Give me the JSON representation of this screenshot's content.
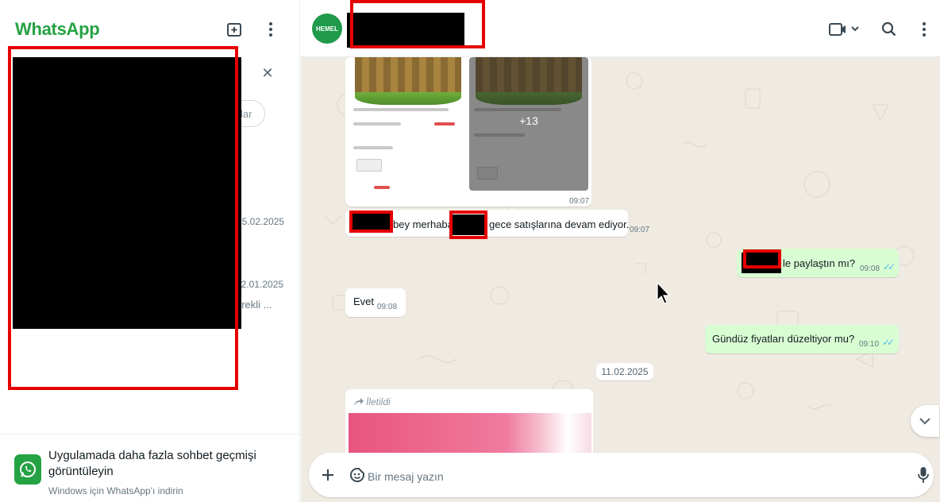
{
  "app": {
    "brand": "WhatsApp"
  },
  "sidebar": {
    "chats": [
      {
        "date": "15.02.2025"
      },
      {
        "date": "12.01.2025",
        "preview": "ürekli ..."
      }
    ],
    "filter_chip_label": "lar",
    "footer": {
      "title": "Uygulamada daha fazla sohbet geçmişi görüntüleyin",
      "subtitle": "Windows için WhatsApp'ı indirin"
    }
  },
  "chat": {
    "avatar_text": "HEMEL",
    "messages": [
      {
        "dir": "in",
        "text": "",
        "time": "09:07",
        "kind": "product-images",
        "extra_count": "+13"
      },
      {
        "dir": "in",
        "text_a": "bey merhaba",
        "text_b": "gece satışlarına devam ediyor.",
        "time": "09:07"
      },
      {
        "dir": "out",
        "text": "le paylaştın mı?",
        "time": "09:08"
      },
      {
        "dir": "in",
        "text": "Evet",
        "time": "09:08"
      },
      {
        "dir": "out",
        "text": "Gündüz fiyatları düzeltiyor mu?",
        "time": "09:10"
      }
    ],
    "date_divider": "11.02.2025",
    "forwarded_label": "İletildi"
  },
  "composer": {
    "placeholder": "Bir mesaj yazın"
  },
  "colors": {
    "brand_green": "#25a244",
    "redaction_red": "#e60000",
    "out_bubble": "#d9fdd3",
    "read_tick": "#53bdeb"
  },
  "icons": [
    "new-chat-icon",
    "menu-icon",
    "close-icon",
    "video-call-icon",
    "search-icon",
    "plus-icon",
    "sticker-icon",
    "mic-icon",
    "chevron-down-icon",
    "forward-icon",
    "whatsapp-logo-icon",
    "mouse-cursor-icon"
  ]
}
